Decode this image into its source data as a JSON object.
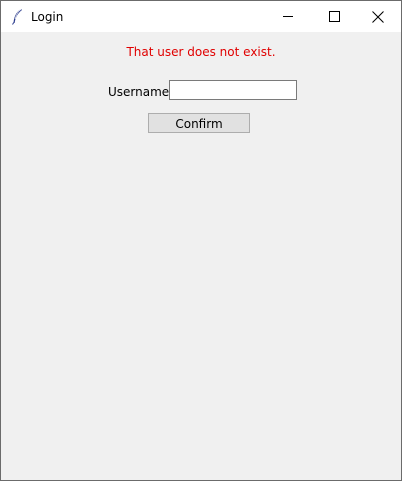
{
  "window": {
    "title": "Login",
    "icon": "feather-icon",
    "controls": {
      "minimize_icon": "minimize-icon",
      "maximize_icon": "maximize-icon",
      "close_icon": "close-icon"
    }
  },
  "form": {
    "error_message": "That user does not exist.",
    "error_color": "#e00000",
    "username_label": "Username",
    "username_value": "",
    "confirm_label": "Confirm"
  }
}
